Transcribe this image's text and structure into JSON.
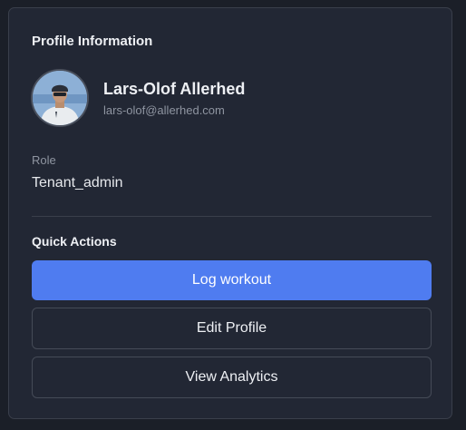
{
  "profile": {
    "section_title": "Profile Information",
    "avatar_icon": "user-photo-avatar",
    "name": "Lars-Olof Allerhed",
    "email": "lars-olof@allerhed.com",
    "role_label": "Role",
    "role_value": "Tenant_admin"
  },
  "quick_actions": {
    "title": "Quick Actions",
    "buttons": [
      {
        "label": "Log workout",
        "variant": "primary"
      },
      {
        "label": "Edit Profile",
        "variant": "outline"
      },
      {
        "label": "View Analytics",
        "variant": "outline"
      }
    ]
  },
  "colors": {
    "background": "#1b1f28",
    "card": "#222734",
    "accent": "#4f7cf0",
    "muted_text": "#8f95a1"
  }
}
